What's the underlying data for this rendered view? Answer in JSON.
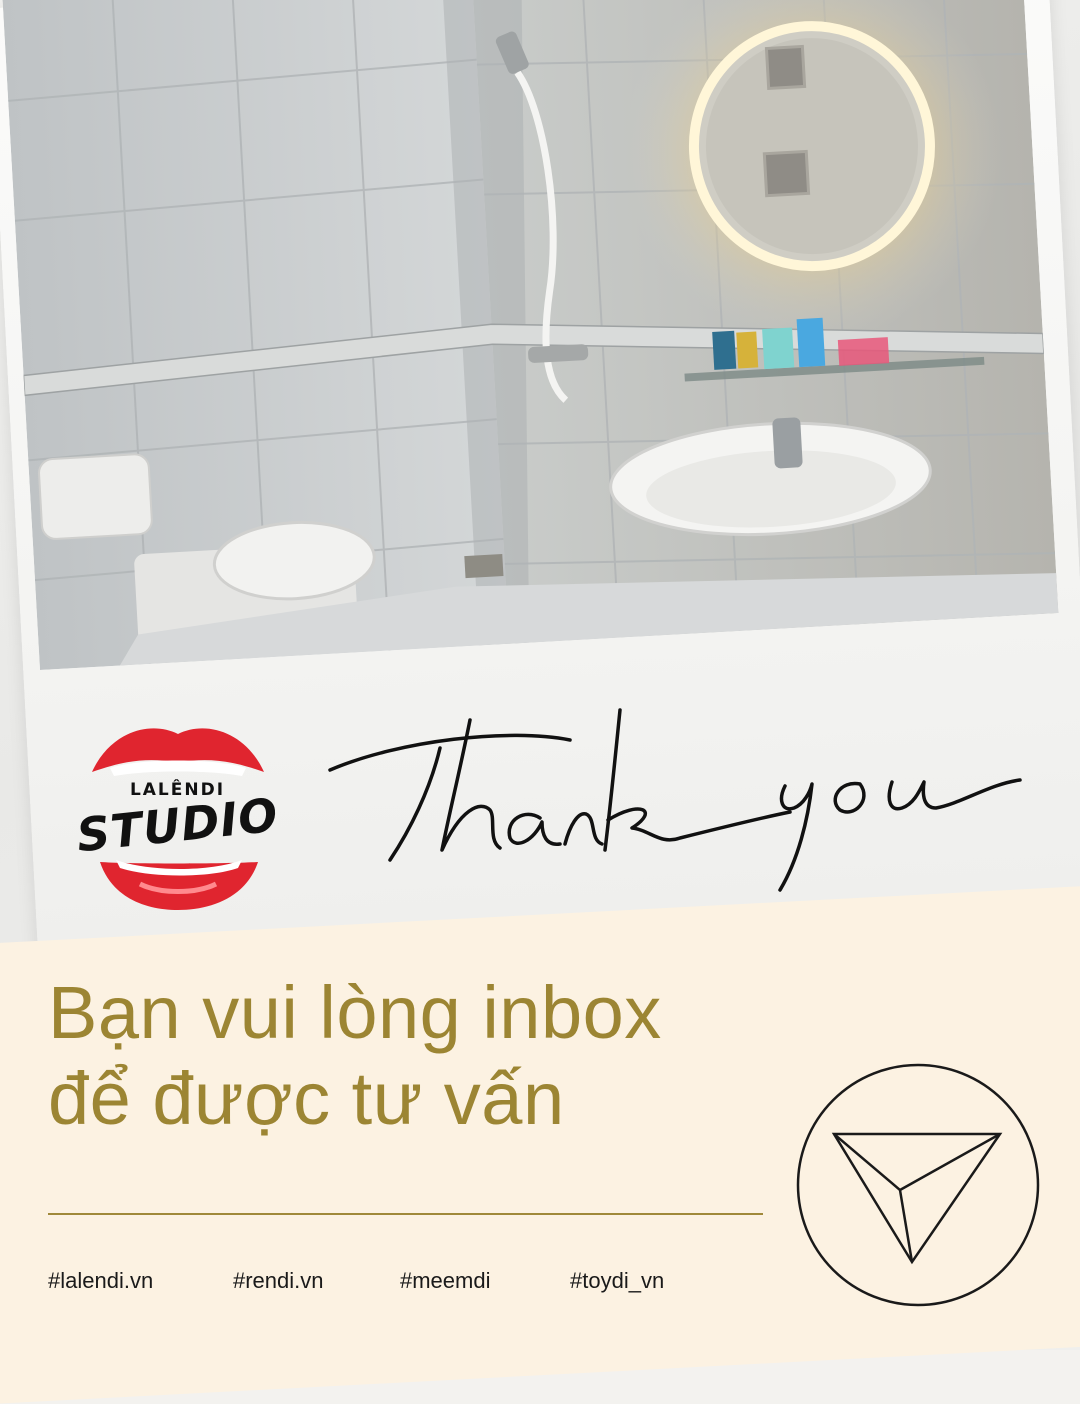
{
  "logo": {
    "small_text": "LALÊNDI",
    "big_text": "STUDIO",
    "lips_color": "#e0252f"
  },
  "script_text": "Thank you",
  "headline": {
    "line1": "Bạn vui lòng inbox",
    "line2": "để được tư vấn"
  },
  "hashtags": [
    "#lalendi.vn",
    "#rendi.vn",
    "#meemdi",
    "#toydi_vn"
  ],
  "send_icon": "send-paper-plane-icon",
  "colors": {
    "gold": "#9c8533",
    "cream": "#fcf2e2",
    "ink": "#111111"
  }
}
